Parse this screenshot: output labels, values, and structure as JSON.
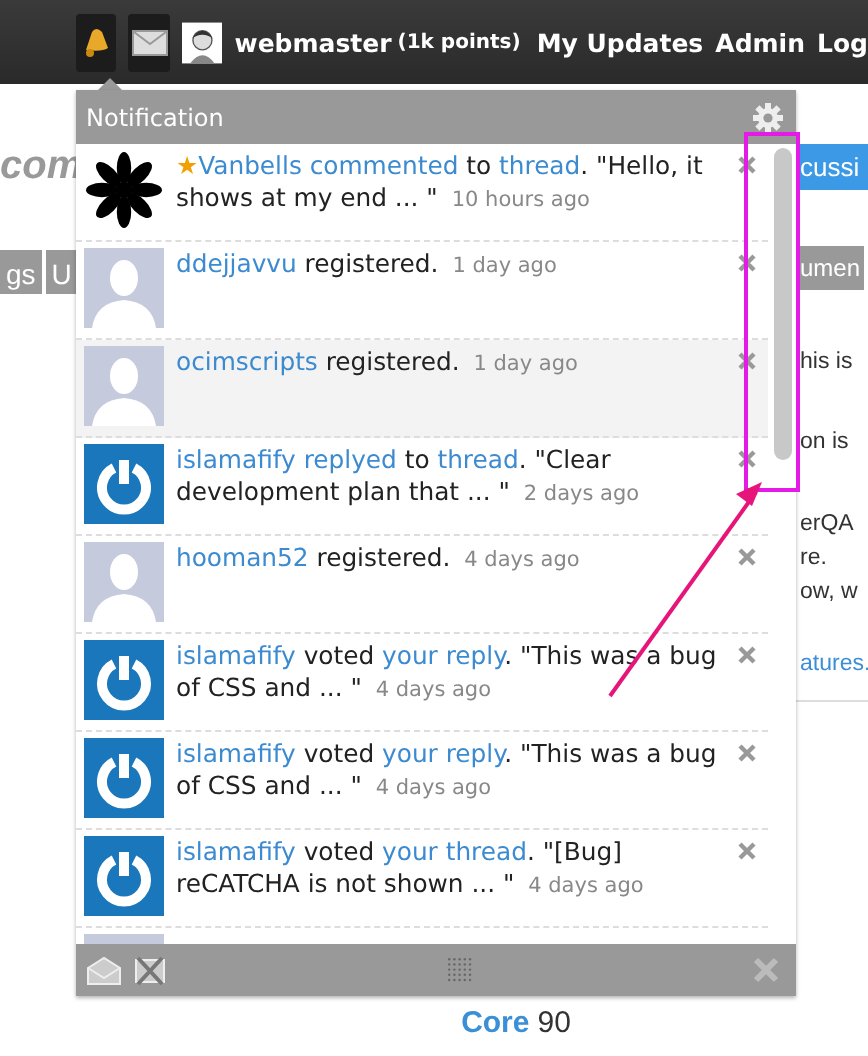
{
  "topbar": {
    "user": "webmaster",
    "points": "(1k points)",
    "links": [
      "My Updates",
      "Admin",
      "Log"
    ]
  },
  "page": {
    "heading": "com",
    "tabs_left": [
      "gs",
      "U"
    ],
    "button": "cussi",
    "tab_right": "umen",
    "lines": [
      "his is",
      "on is",
      "erQA",
      "re.",
      "ow, w"
    ],
    "link": "atures.",
    "footer_bold": "Core",
    "footer_count": "90"
  },
  "notification": {
    "title": "Notification",
    "items": [
      {
        "kind": "logo",
        "highlighted": false,
        "parts": [
          {
            "kind": "star",
            "text": "★"
          },
          {
            "kind": "link",
            "text": "Vanbells commented"
          },
          {
            "kind": "text",
            "text": " to "
          },
          {
            "kind": "link",
            "text": "thread"
          },
          {
            "kind": "text",
            "text": ". \"Hello, it shows at my end ... \""
          }
        ],
        "time": "10 hours ago"
      },
      {
        "kind": "silhouette",
        "highlighted": false,
        "parts": [
          {
            "kind": "link",
            "text": "ddejjavvu"
          },
          {
            "kind": "text",
            "text": " registered."
          }
        ],
        "time": "1 day ago"
      },
      {
        "kind": "silhouette",
        "highlighted": true,
        "parts": [
          {
            "kind": "link",
            "text": "ocimscripts"
          },
          {
            "kind": "text",
            "text": " registered."
          }
        ],
        "time": "1 day ago"
      },
      {
        "kind": "power",
        "highlighted": false,
        "parts": [
          {
            "kind": "link",
            "text": "islamafify replyed"
          },
          {
            "kind": "text",
            "text": " to "
          },
          {
            "kind": "link",
            "text": "thread"
          },
          {
            "kind": "text",
            "text": ". \"Clear development plan that ... \""
          }
        ],
        "time": "2 days ago"
      },
      {
        "kind": "silhouette",
        "highlighted": false,
        "parts": [
          {
            "kind": "link",
            "text": "hooman52"
          },
          {
            "kind": "text",
            "text": " registered."
          }
        ],
        "time": "4 days ago"
      },
      {
        "kind": "power",
        "highlighted": false,
        "parts": [
          {
            "kind": "link",
            "text": "islamafify"
          },
          {
            "kind": "text",
            "text": " voted "
          },
          {
            "kind": "link",
            "text": "your reply"
          },
          {
            "kind": "text",
            "text": ". \"This was a bug of CSS and ... \""
          }
        ],
        "time": "4 days ago"
      },
      {
        "kind": "power",
        "highlighted": false,
        "parts": [
          {
            "kind": "link",
            "text": "islamafify"
          },
          {
            "kind": "text",
            "text": " voted "
          },
          {
            "kind": "link",
            "text": "your reply"
          },
          {
            "kind": "text",
            "text": ". \"This was a bug of CSS and ... \""
          }
        ],
        "time": "4 days ago"
      },
      {
        "kind": "power",
        "highlighted": false,
        "parts": [
          {
            "kind": "link",
            "text": "islamafify"
          },
          {
            "kind": "text",
            "text": " voted "
          },
          {
            "kind": "link",
            "text": "your thread"
          },
          {
            "kind": "text",
            "text": ". \"[Bug] reCATCHA is not shown ... \""
          }
        ],
        "time": "4 days ago"
      }
    ]
  }
}
